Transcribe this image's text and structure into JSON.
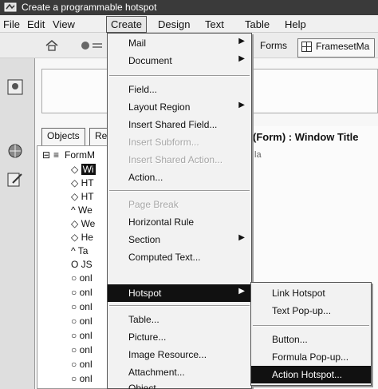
{
  "window": {
    "title": "Create a programmable hotspot"
  },
  "menubar": {
    "items": [
      {
        "label": "File"
      },
      {
        "label": "Edit"
      },
      {
        "label": "View"
      },
      {
        "label": "Create",
        "active": true
      },
      {
        "label": "Design"
      },
      {
        "label": "Text"
      },
      {
        "label": "Table"
      },
      {
        "label": "Help"
      }
    ]
  },
  "toolbar": {
    "forms_label": "Forms",
    "framesetma_label": "FramesetMa"
  },
  "object_tabs": {
    "objects": "Objects",
    "reference": "Re"
  },
  "tree": {
    "root": "FormM",
    "items": [
      "Wi",
      "HT",
      "HT",
      "We",
      "We",
      "He",
      "Ta",
      "JS",
      "onl",
      "onl",
      "onl",
      "onl",
      "onl",
      "onl",
      "onl",
      "onl"
    ]
  },
  "right_pane": {
    "header": "(Form) : Window Title",
    "sub": "la"
  },
  "create_menu": {
    "items": [
      {
        "label": "Mail",
        "submenu": true
      },
      {
        "label": "Document",
        "submenu": true
      },
      {
        "separator": true
      },
      {
        "label": "Field..."
      },
      {
        "label": "Layout Region",
        "submenu": true
      },
      {
        "label": "Insert Shared Field..."
      },
      {
        "label": "Insert Subform...",
        "disabled": true
      },
      {
        "label": "Insert Shared Action...",
        "disabled": true
      },
      {
        "label": "Action..."
      },
      {
        "separator": true
      },
      {
        "label": "Page Break",
        "disabled": true
      },
      {
        "label": "Horizontal Rule"
      },
      {
        "label": "Section",
        "submenu": true
      },
      {
        "label": "Computed Text..."
      },
      {
        "label": "Hotspot",
        "submenu": true,
        "highlighted": true
      },
      {
        "separator": true
      },
      {
        "label": "Table..."
      },
      {
        "label": "Picture..."
      },
      {
        "label": "Image Resource..."
      },
      {
        "label": "Attachment..."
      },
      {
        "label": "Object..."
      }
    ]
  },
  "hotspot_submenu": {
    "items": [
      {
        "label": "Link Hotspot"
      },
      {
        "label": "Text Pop-up..."
      },
      {
        "separator": true
      },
      {
        "label": "Button..."
      },
      {
        "label": "Formula Pop-up..."
      },
      {
        "label": "Action Hotspot...",
        "highlighted": true
      }
    ]
  }
}
